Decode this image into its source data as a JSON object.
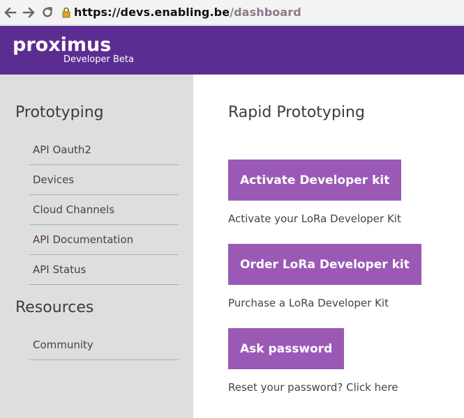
{
  "browser": {
    "url_host": "https://devs.enabling.be",
    "url_path": "/dashboard",
    "icons": [
      "back-arrow-icon",
      "forward-arrow-icon",
      "reload-icon",
      "lock-icon"
    ]
  },
  "header": {
    "logo": "proximus",
    "tagline": "Developer Beta",
    "background_color": "#5c2d91"
  },
  "sidebar": {
    "sections": [
      {
        "heading": "Prototyping",
        "items": [
          {
            "label": "API Oauth2"
          },
          {
            "label": "Devices"
          },
          {
            "label": "Cloud Channels"
          },
          {
            "label": "API Documentation"
          },
          {
            "label": "API Status"
          }
        ]
      },
      {
        "heading": "Resources",
        "items": [
          {
            "label": "Community"
          }
        ]
      }
    ],
    "background_color": "#dedede"
  },
  "main": {
    "title": "Rapid Prototyping",
    "actions": [
      {
        "label": "Activate Developer kit",
        "description": "Activate your LoRa Developer Kit"
      },
      {
        "label": "Order LoRa Developer kit",
        "description": "Purchase a LoRa Developer Kit"
      },
      {
        "label": "Ask password",
        "description_prefix": "Reset your password?",
        "description_link": "Click here"
      }
    ],
    "button_color": "#9b59b6"
  }
}
